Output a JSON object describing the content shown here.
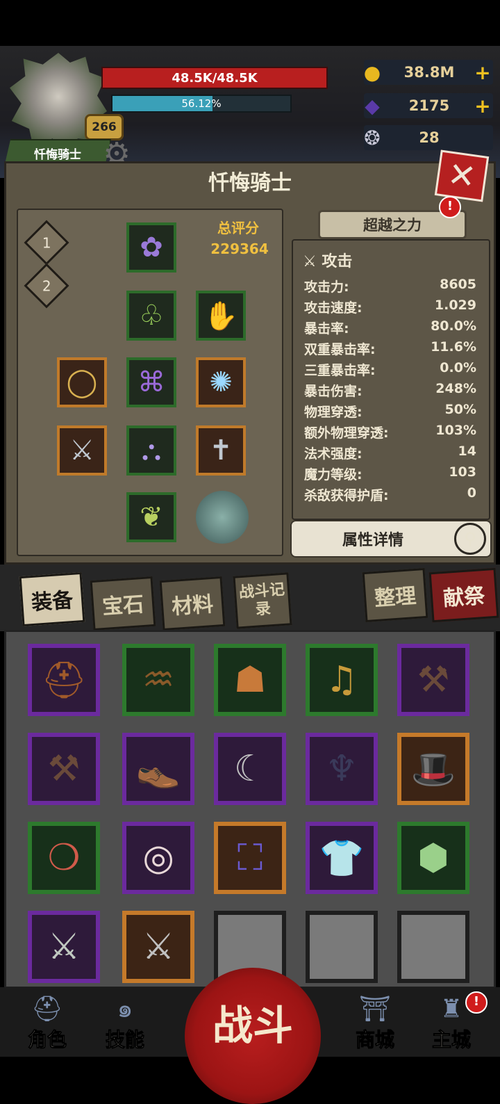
{
  "player": {
    "hp_text": "48.5K/48.5K",
    "exp_percent": 56.12,
    "exp_text": "56.12%",
    "level": "266",
    "name": "忏悔骑士"
  },
  "resources": {
    "gold": "38.8M",
    "crystal": "2175",
    "horn": "28"
  },
  "panel": {
    "title": "忏悔骑士",
    "score_label": "总评分",
    "score_value": "229364",
    "transcend_label": "超越之力",
    "alert": "!",
    "slot_buttons": [
      "1",
      "2"
    ]
  },
  "stats": {
    "header": "攻击",
    "rows": [
      {
        "label": "攻击力:",
        "value": "8605"
      },
      {
        "label": "攻击速度:",
        "value": "1.029"
      },
      {
        "label": "暴击率:",
        "value": "80.0%"
      },
      {
        "label": "双重暴击率:",
        "value": "11.6%"
      },
      {
        "label": "三重暴击率:",
        "value": "0.0%"
      },
      {
        "label": "暴击伤害:",
        "value": "248%"
      },
      {
        "label": "物理穿透:",
        "value": "50%"
      },
      {
        "label": "额外物理穿透:",
        "value": "103%"
      },
      {
        "label": "法术强度:",
        "value": "14"
      },
      {
        "label": "魔力等级:",
        "value": "103"
      },
      {
        "label": "杀敌获得护盾:",
        "value": "0"
      }
    ],
    "detail_button": "属性详情"
  },
  "tabs": {
    "equipment": "装备",
    "gems": "宝石",
    "materials": "材料",
    "battle_record": "战斗记录",
    "sort": "整理",
    "sacrifice": "献祭"
  },
  "nav": {
    "character": "角色",
    "skills": "技能",
    "fight": "战斗",
    "shop": "商城",
    "main_city": "主城",
    "alert": "!"
  },
  "icons": {
    "gold": "coin-icon",
    "crystal": "crystal-icon",
    "horn": "ram-horn-icon"
  }
}
